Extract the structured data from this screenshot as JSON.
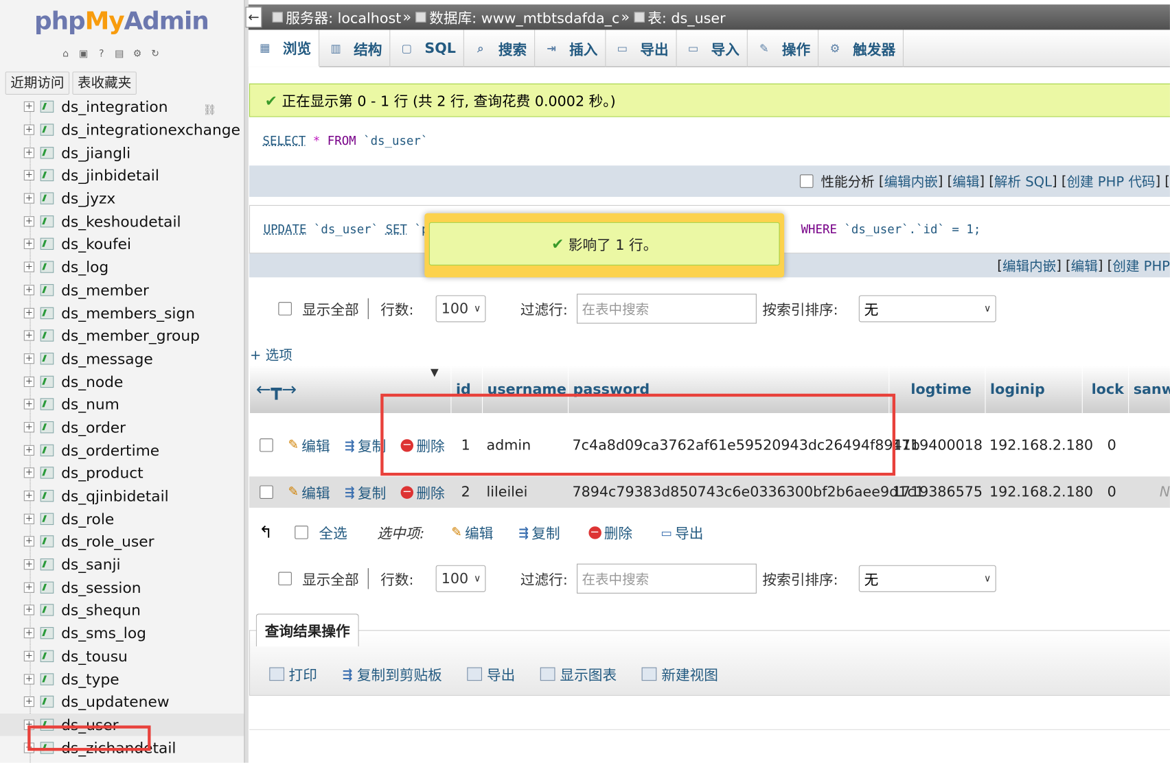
{
  "sidebar": {
    "logo": {
      "php": "php",
      "my": "My",
      "admin": "Admin"
    },
    "recent_tab": "近期访问",
    "favorites_tab": "表收藏夹",
    "tables": [
      "ds_integration",
      "ds_integrationexchange",
      "ds_jiangli",
      "ds_jinbidetail",
      "ds_jyzx",
      "ds_keshoudetail",
      "ds_koufei",
      "ds_log",
      "ds_member",
      "ds_members_sign",
      "ds_member_group",
      "ds_message",
      "ds_node",
      "ds_num",
      "ds_order",
      "ds_ordertime",
      "ds_product",
      "ds_qjinbidetail",
      "ds_role",
      "ds_role_user",
      "ds_sanji",
      "ds_session",
      "ds_shequn",
      "ds_sms_log",
      "ds_tousu",
      "ds_type",
      "ds_updatenew",
      "ds_user",
      "ds_zichandetail"
    ],
    "active_table": "ds_user"
  },
  "breadcrumb": {
    "server": "服务器: localhost",
    "database": "数据库: www_mtbtsdafda_c",
    "table": "表: ds_user",
    "sep": "»"
  },
  "tabs": [
    "浏览",
    "结构",
    "SQL",
    "搜索",
    "插入",
    "导出",
    "导入",
    "操作",
    "触发器"
  ],
  "success_message": "正在显示第 0 - 1 行 (共 2 行, 查询花费 0.0002 秒。)",
  "sql1": {
    "select": "SELECT",
    "star": "*",
    "from": "FROM",
    "table": "`ds_user`"
  },
  "sql1_bar": {
    "profiling": "性能分析",
    "links": [
      "编辑内嵌",
      "编辑",
      "解析 SQL",
      "创建 PHP 代码"
    ]
  },
  "sql2": {
    "update": "UPDATE",
    "table": "`ds_user`",
    "set": "SET",
    "field_start": "`pa",
    "where": "WHERE",
    "cond": "`ds_user`.`id` = 1;"
  },
  "sql2_bar": {
    "links": [
      "编辑内嵌",
      "编辑",
      "创建 PHP"
    ]
  },
  "popup_message": "影响了 1 行。",
  "nav": {
    "show_all": "显示全部",
    "rows_label": "行数:",
    "rows_value": "100",
    "filter_label": "过滤行:",
    "filter_placeholder": "在表中搜索",
    "sort_label": "按索引排序:",
    "sort_value": "无"
  },
  "options_link": "+ 选项",
  "columns": [
    "id",
    "username",
    "password",
    "logtime",
    "loginip",
    "lock",
    "sanwa"
  ],
  "actions": {
    "edit": "编辑",
    "copy": "复制",
    "delete": "删除"
  },
  "rows": [
    {
      "id": "1",
      "username": "admin",
      "password": "7c4a8d09ca3762af61e59520943dc26494f8941b",
      "logtime": "1719400018",
      "loginip": "192.168.2.180",
      "lock": "0",
      "sanwa": ""
    },
    {
      "id": "2",
      "username": "lileilei",
      "password": "7894c79383d850743c6e0336300bf2b6aee9d1c1",
      "logtime": "1719386575",
      "loginip": "192.168.2.180",
      "lock": "0",
      "sanwa": "N"
    }
  ],
  "bulk": {
    "select_all": "全选",
    "with_selected": "选中项:",
    "edit": "编辑",
    "copy": "复制",
    "delete": "删除",
    "export": "导出"
  },
  "query_results": {
    "title": "查询结果操作",
    "items": [
      "打印",
      "复制到剪贴板",
      "导出",
      "显示图表",
      "新建视图"
    ]
  },
  "colors": {
    "link": "#235a81",
    "success_bg": "#ebf8a4",
    "popup_border": "#fcd24d",
    "highlight": "#e8413b"
  }
}
